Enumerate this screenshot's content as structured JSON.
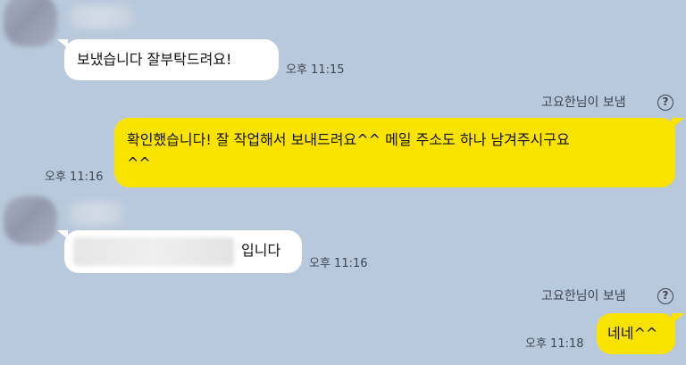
{
  "messages": [
    {
      "direction": "incoming",
      "text": "보냈습니다 잘부탁드려요!",
      "time": "오후 11:15"
    },
    {
      "direction": "outgoing",
      "sender_note": "고요한님이 보냄",
      "text_line1": "확인했습니다! 잘 작업해서 보내드려요^^ 메일 주소도 하나 남겨주시구요",
      "text_line2": "^^",
      "time": "오후 11:16"
    },
    {
      "direction": "incoming",
      "text_suffix": "입니다",
      "time": "오후 11:16"
    },
    {
      "direction": "outgoing",
      "sender_note": "고요한님이 보냄",
      "text": "네네^^",
      "time": "오후 11:18"
    }
  ],
  "icons": {
    "help": "?"
  },
  "colors": {
    "background": "#b9c9dd",
    "incoming_bubble": "#ffffff",
    "outgoing_bubble": "#fbe300"
  }
}
